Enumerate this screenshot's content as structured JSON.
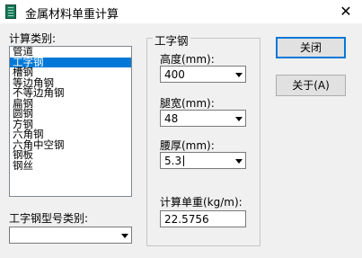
{
  "window": {
    "title": "金属材料单重计算",
    "close_glyph": "✕"
  },
  "left": {
    "category_label": "计算类别:",
    "categories": [
      "管道",
      "工字钢",
      "槽钢",
      "等边角钢",
      "不等边角钢",
      "扁钢",
      "圆钢",
      "方钢",
      "六角钢",
      "六角中空钢",
      "钢板",
      "钢丝"
    ],
    "selected_category": "工字钢",
    "type_label": "工字钢型号类别:",
    "type_value": ""
  },
  "group": {
    "title": "工字钢",
    "height_label": "高度(mm):",
    "height_value": "400",
    "width_label": "腿宽(mm):",
    "width_value": "48",
    "thickness_label": "腰厚(mm):",
    "thickness_value": "5.3",
    "unit_weight_label": "计算单重(kg/m):",
    "unit_weight_value": "22.5756"
  },
  "buttons": {
    "close": "关闭",
    "about": "关于(A)"
  },
  "colors": {
    "selection": "#0078d7",
    "icon": "#1a7a5a"
  }
}
